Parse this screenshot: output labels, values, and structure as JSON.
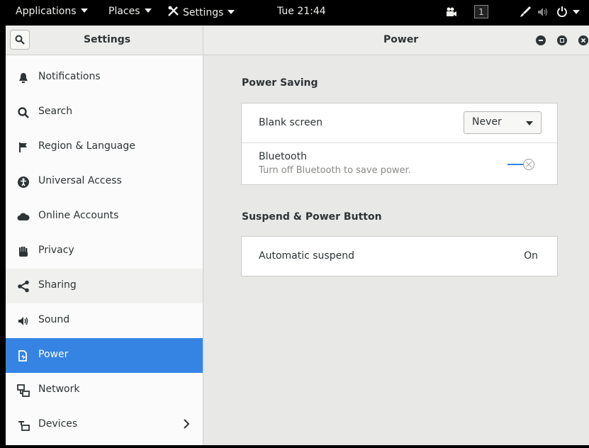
{
  "topbar": {
    "applications": "Applications",
    "places": "Places",
    "app_menu": "Settings",
    "clock": "Tue 21:44",
    "workspace": "1"
  },
  "headerbar": {
    "left_title": "Settings",
    "right_title": "Power"
  },
  "sidebar": {
    "items": [
      {
        "label": "Notifications",
        "icon": "bell-icon"
      },
      {
        "label": "Search",
        "icon": "search-icon"
      },
      {
        "label": "Region & Language",
        "icon": "flag-icon"
      },
      {
        "label": "Universal Access",
        "icon": "accessibility-icon"
      },
      {
        "label": "Online Accounts",
        "icon": "cloud-icon"
      },
      {
        "label": "Privacy",
        "icon": "hand-icon"
      },
      {
        "label": "Sharing",
        "icon": "share-icon"
      },
      {
        "label": "Sound",
        "icon": "speaker-icon"
      },
      {
        "label": "Power",
        "icon": "power-plug-icon"
      },
      {
        "label": "Network",
        "icon": "network-icon"
      },
      {
        "label": "Devices",
        "icon": "devices-icon"
      }
    ],
    "selected": "Power"
  },
  "power": {
    "saving_title": "Power Saving",
    "blank_screen_label": "Blank screen",
    "blank_screen_value": "Never",
    "bluetooth_label": "Bluetooth",
    "bluetooth_sub": "Turn off Bluetooth to save power.",
    "bluetooth_enabled": false,
    "suspend_title": "Suspend & Power Button",
    "auto_suspend_label": "Automatic suspend",
    "auto_suspend_value": "On"
  },
  "colors": {
    "accent": "#3584e4",
    "topbar": "#000000",
    "sidebar_bg": "#fbfbfb",
    "content_bg": "#e8e8e7"
  }
}
